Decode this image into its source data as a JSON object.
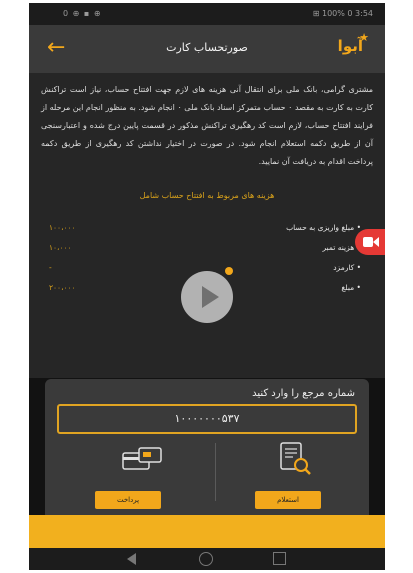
{
  "status_bar": {
    "left": "0 ⊕ ▪ ⊕",
    "right": "⊞ 100% 0 3:54"
  },
  "header": {
    "title": "صورتحساب کارت",
    "logo": "آبوا"
  },
  "intro_text": "مشتری گرامی، بانک ملی برای انتقال آنی هزینه های لازم جهت افتتاح حساب، نیاز است تراکنش کارت به کارت به مقصد ۰ حساب متمرکز اسناد بانک ملی ۰ انجام شود. به منظور انجام این مرحله از فرایند افتتاح حساب، لازم است کد رهگیری تراکنش مذکور در قسمت پایین درج شده و اعتبارسنجی آن از طریق دکمه استعلام انجام شود. در صورت در اختیار نداشتن کد رهگیری از طریق دکمه پرداخت اقدام به دریافت آن نمایید.",
  "costs_heading": "هزینه های مربوط به افتتاح حساب شامل",
  "cost_items": [
    {
      "label": "• مبلغ واریزی به حساب",
      "amount": "۱۰۰،۰۰۰"
    },
    {
      "label": "• هزینه تمبر",
      "amount": "۱۰،۰۰۰"
    },
    {
      "label": "• کارمزد",
      "amount": "-"
    },
    {
      "label": "• مبلغ",
      "amount": "۲۰۰،۰۰۰"
    }
  ],
  "reference": {
    "label": "شماره مرجع را وارد کنید",
    "value": "۱۰۰۰۰۰۰۰۵۳۷"
  },
  "buttons": {
    "pay": "پرداخت",
    "inquiry": "استعلام"
  },
  "icons": {
    "back": "back-arrow-icon",
    "logo": "star-icon",
    "record": "video-camera-icon",
    "play": "play-icon",
    "pay": "card-payment-icon",
    "inquiry": "receipt-search-icon"
  },
  "colors": {
    "accent": "#f2a71b",
    "record": "#e53935"
  }
}
